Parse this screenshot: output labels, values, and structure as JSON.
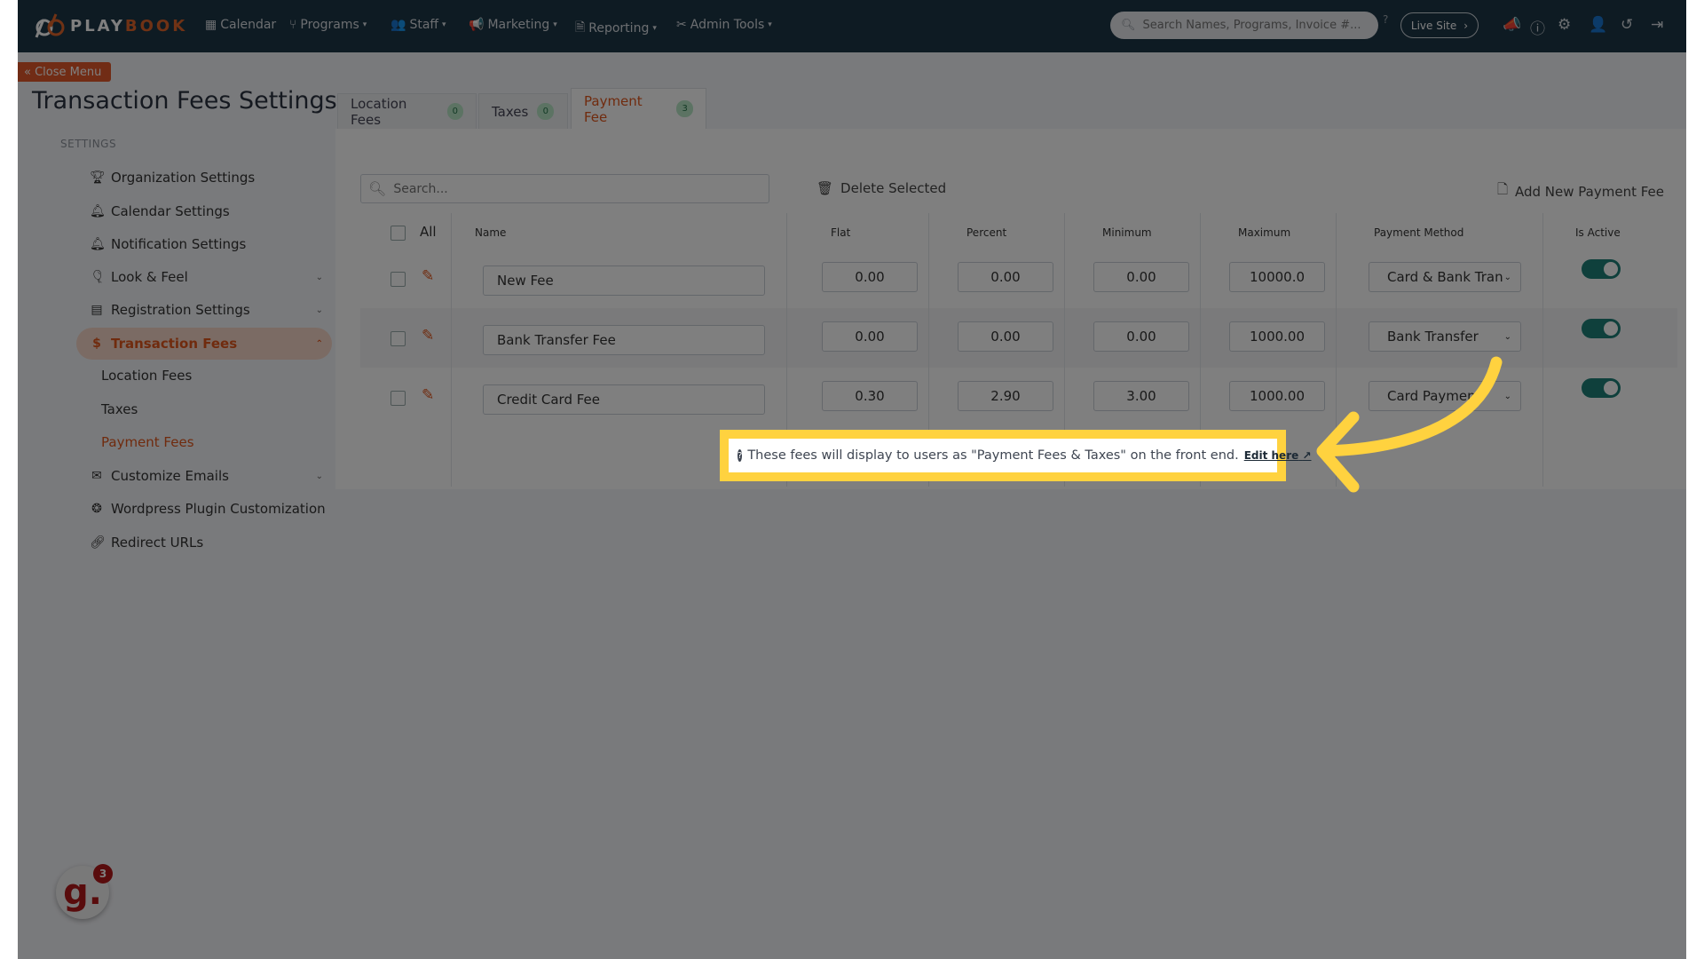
{
  "nav": {
    "logo": "PLAYBOOK",
    "logo_a": "PLAY",
    "logo_b": "BOOK",
    "items": [
      {
        "label": "Calendar",
        "icon": "calendar-icon"
      },
      {
        "label": "Programs",
        "icon": "branch-icon"
      },
      {
        "label": "Staff",
        "icon": "users-icon"
      },
      {
        "label": "Marketing",
        "icon": "megaphone-icon"
      },
      {
        "label": "Reporting",
        "icon": "document-icon"
      },
      {
        "label": "Admin Tools",
        "icon": "tools-icon"
      }
    ],
    "search_placeholder": "Search Names, Programs, Invoice #...",
    "live_site": "Live Site",
    "icons": [
      "announcement-icon",
      "help-icon",
      "gear-icon",
      "add-user-icon",
      "history-icon",
      "logout-icon"
    ]
  },
  "close_menu": "Close Menu",
  "page_title": "Transaction Fees Settings",
  "sidebar": {
    "heading": "SETTINGS",
    "items": [
      {
        "label": "Organization Settings"
      },
      {
        "label": "Calendar Settings"
      },
      {
        "label": "Notification Settings"
      },
      {
        "label": "Look & Feel"
      },
      {
        "label": "Registration Settings"
      },
      {
        "label": "Transaction Fees"
      },
      {
        "label": "Customize Emails"
      },
      {
        "label": "Wordpress Plugin Customization"
      },
      {
        "label": "Redirect URLs"
      }
    ],
    "subitems": [
      {
        "label": "Location Fees"
      },
      {
        "label": "Taxes"
      },
      {
        "label": "Payment Fees"
      }
    ]
  },
  "tabs": [
    {
      "label": "Location Fees",
      "count": "0"
    },
    {
      "label": "Taxes",
      "count": "0"
    },
    {
      "label": "Payment Fee",
      "count": "3"
    }
  ],
  "toolbar": {
    "search_placeholder": "Search...",
    "delete": "Delete Selected",
    "add": "Add New Payment Fee"
  },
  "table": {
    "headers": {
      "all": "All",
      "name": "Name",
      "flat": "Flat",
      "percent": "Percent",
      "minimum": "Minimum",
      "maximum": "Maximum",
      "method": "Payment Method",
      "active": "Is Active"
    },
    "rows": [
      {
        "name": "New Fee",
        "flat": "0.00",
        "percent": "0.00",
        "minimum": "0.00",
        "maximum": "10000.0",
        "method": "Card & Bank Tran",
        "active": true
      },
      {
        "name": "Bank Transfer Fee",
        "flat": "0.00",
        "percent": "0.00",
        "minimum": "0.00",
        "maximum": "1000.00",
        "method": "Bank Transfer",
        "active": true
      },
      {
        "name": "Credit Card Fee",
        "flat": "0.30",
        "percent": "2.90",
        "minimum": "3.00",
        "maximum": "1000.00",
        "method": "Card Payment",
        "active": true
      }
    ]
  },
  "note": {
    "text": "These fees will display to users as \"Payment Fees & Taxes\" on the front end.",
    "link": "Edit here"
  },
  "widget": {
    "letter": "g.",
    "badge": "3"
  },
  "colors": {
    "accent": "#e0561c",
    "header": "#1d3646",
    "toggle": "#1f8178",
    "highlight": "#ffd23f"
  }
}
